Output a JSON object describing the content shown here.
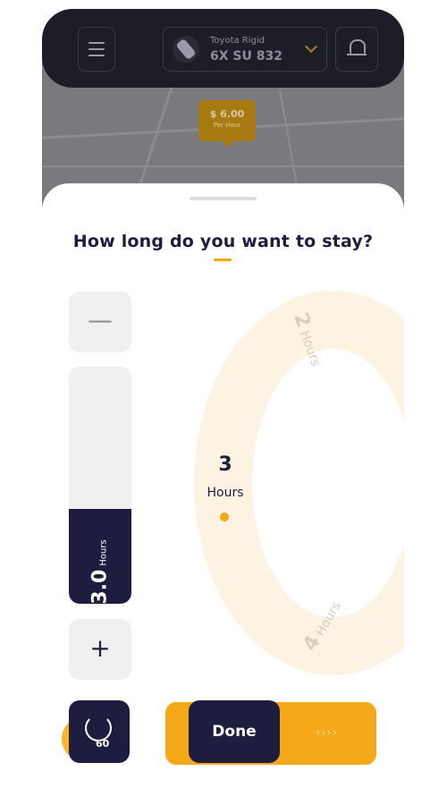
{
  "header": {
    "vehicle_name": "Toyota Rigid",
    "vehicle_plate": "6X SU 832"
  },
  "map": {
    "price": "$ 6.00",
    "price_unit": "Per Hour"
  },
  "sheet": {
    "title": "How long do you want to stay?",
    "minus_label": "—",
    "plus_label": "+",
    "selected_value": "3.0",
    "selected_unit": "Hours",
    "selected_fraction": 0.4,
    "dial": {
      "center_value": "3",
      "center_unit": "Hours",
      "prev_value": "2",
      "prev_unit": "Hours",
      "next_value": "4",
      "next_unit": "Hours"
    },
    "timer_label": "60",
    "done_label": "Done",
    "done_arrows": "››››"
  },
  "colors": {
    "navy": "#1f1d3f",
    "accent": "#f4a712"
  },
  "icons": [
    "menu-icon",
    "car-icon",
    "chevron-down-icon",
    "bell-icon",
    "timer-icon"
  ]
}
